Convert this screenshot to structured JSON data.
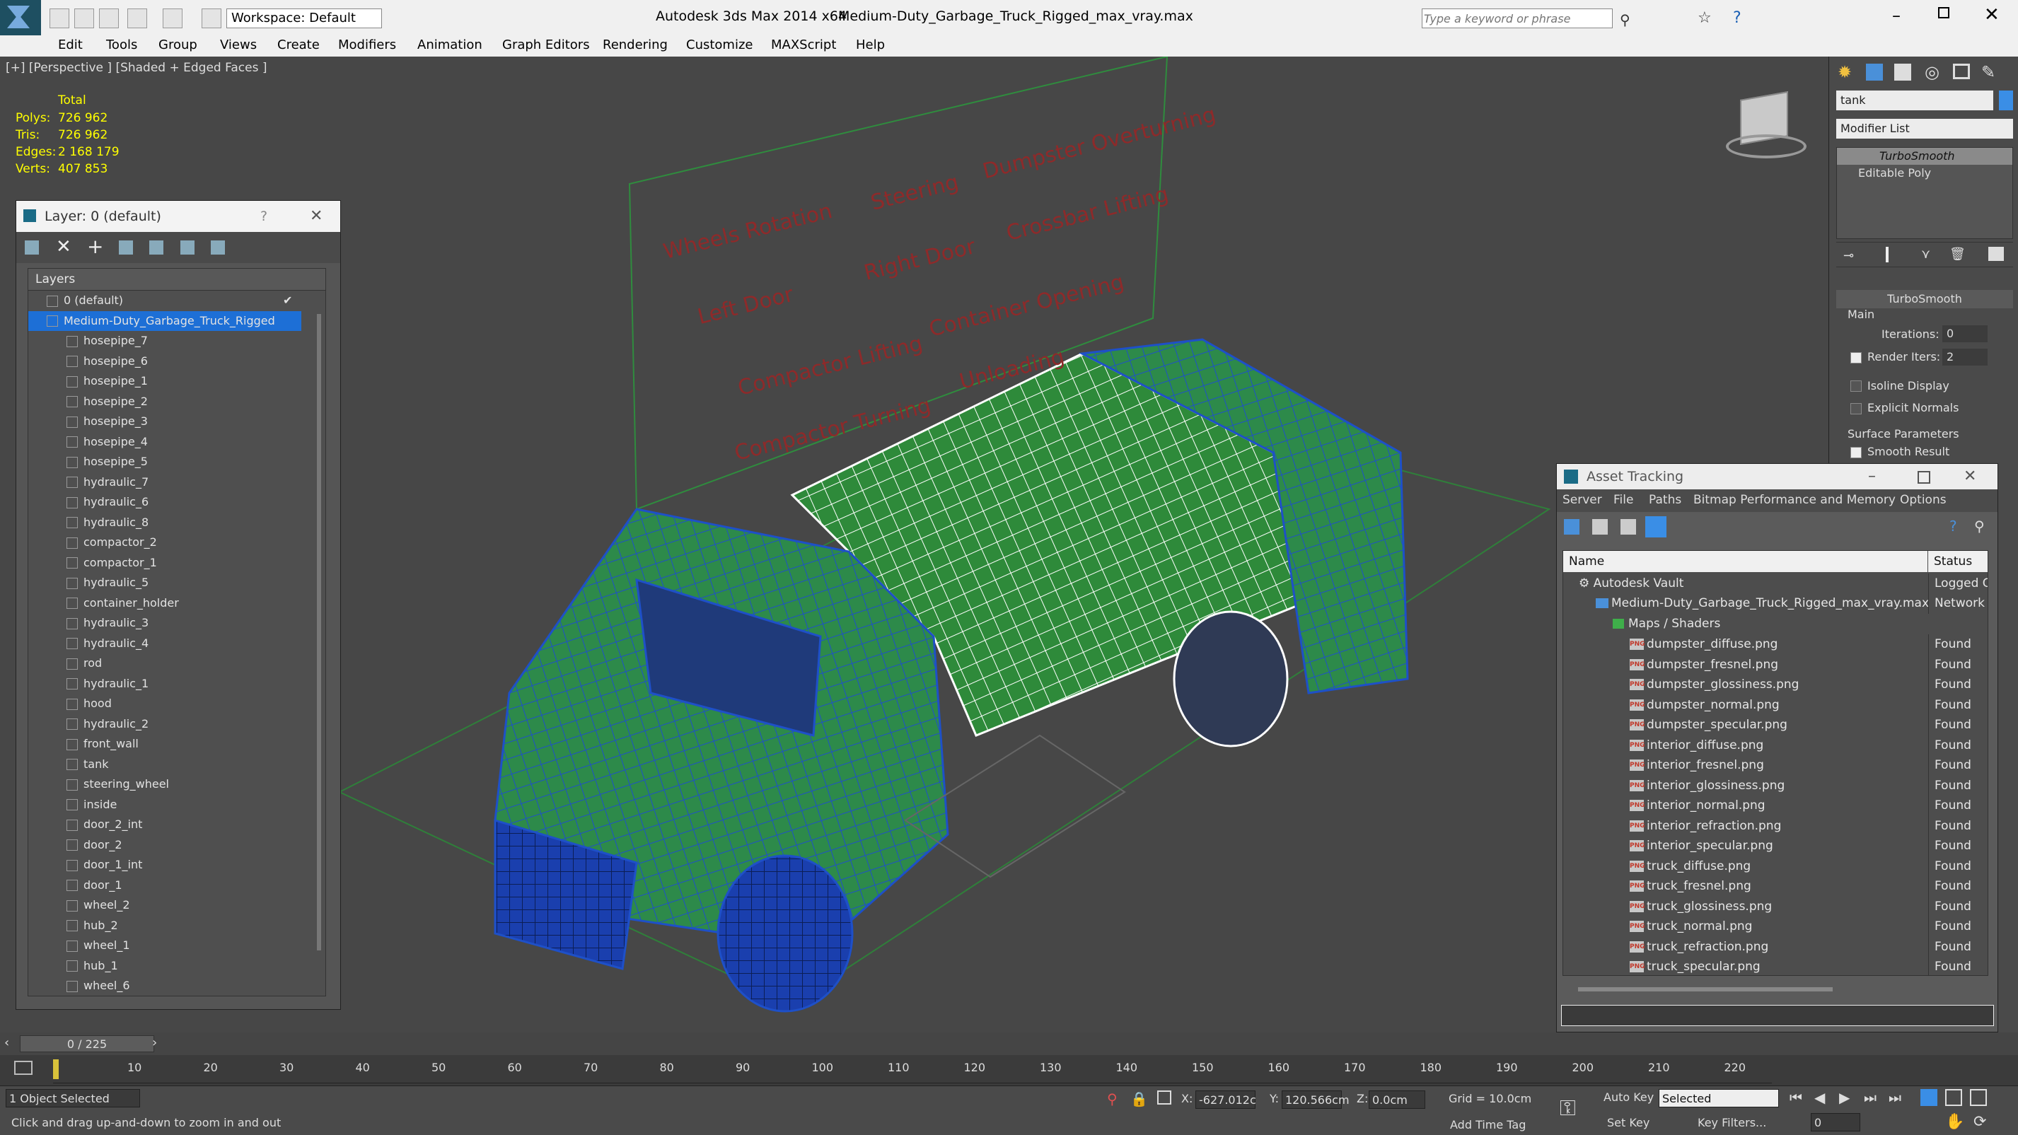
{
  "app": {
    "title": "Autodesk 3ds Max  2014 x64",
    "file": "Medium-Duty_Garbage_Truck_Rigged_max_vray.max",
    "workspace": "Workspace: Default",
    "search_placeholder": "Type a keyword or phrase"
  },
  "menu": [
    "Edit",
    "Tools",
    "Group",
    "Views",
    "Create",
    "Modifiers",
    "Animation",
    "Graph Editors",
    "Rendering",
    "Customize",
    "MAXScript",
    "Help"
  ],
  "viewport": {
    "label": "[+] [Perspective ] [Shaded + Edged Faces ]",
    "stats": {
      "total_label": "Total",
      "rows": [
        {
          "label": "Polys:",
          "value": "726 962"
        },
        {
          "label": "Tris:",
          "value": "726 962"
        },
        {
          "label": "Edges:",
          "value": "2 168 179"
        },
        {
          "label": "Verts:",
          "value": "407 853"
        }
      ]
    },
    "board_labels": [
      "Wheels Rotation",
      "Steering",
      "Dumpster Overturning",
      "Left Door",
      "Right Door",
      "Crossbar Lifting",
      "Compactor Lifting",
      "Container Opening",
      "Compactor Turning",
      "Unloading"
    ]
  },
  "layer_panel": {
    "title": "Layer: 0 (default)",
    "help": "?",
    "column": "Layers",
    "top_layers": [
      "0 (default)",
      "Medium-Duty_Garbage_Truck_Rigged"
    ],
    "items": [
      "hosepipe_7",
      "hosepipe_6",
      "hosepipe_1",
      "hosepipe_2",
      "hosepipe_3",
      "hosepipe_4",
      "hosepipe_5",
      "hydraulic_7",
      "hydraulic_6",
      "hydraulic_8",
      "compactor_2",
      "compactor_1",
      "hydraulic_5",
      "container_holder",
      "hydraulic_3",
      "hydraulic_4",
      "rod",
      "hydraulic_1",
      "hood",
      "hydraulic_2",
      "front_wall",
      "tank",
      "steering_wheel",
      "inside",
      "door_2_int",
      "door_2",
      "door_1_int",
      "door_1",
      "wheel_2",
      "hub_2",
      "wheel_1",
      "hub_1",
      "wheel_6"
    ]
  },
  "command_panel": {
    "object_name": "tank",
    "modifier_list": "Modifier List",
    "stack": [
      "TurboSmooth",
      "Editable Poly"
    ],
    "rollout": "TurboSmooth",
    "main_group": "Main",
    "iterations_label": "Iterations:",
    "iterations": "0",
    "render_iters_label": "Render Iters:",
    "render_iters": "2",
    "isoline": "Isoline Display",
    "explicit": "Explicit Normals",
    "surface_group": "Surface Parameters",
    "smooth_result": "Smooth Result"
  },
  "asset_tracking": {
    "title": "Asset Tracking",
    "menu": [
      "Server",
      "File",
      "Paths",
      "Bitmap Performance and Memory",
      "Options"
    ],
    "col_name": "Name",
    "col_status": "Status",
    "vault": {
      "name": "Autodesk Vault",
      "status": "Logged O"
    },
    "file": {
      "name": "Medium-Duty_Garbage_Truck_Rigged_max_vray.max",
      "status": "Network"
    },
    "group": "Maps / Shaders",
    "png_tag": "PNG",
    "maps": [
      {
        "name": "dumpster_diffuse.png",
        "status": "Found"
      },
      {
        "name": "dumpster_fresnel.png",
        "status": "Found"
      },
      {
        "name": "dumpster_glossiness.png",
        "status": "Found"
      },
      {
        "name": "dumpster_normal.png",
        "status": "Found"
      },
      {
        "name": "dumpster_specular.png",
        "status": "Found"
      },
      {
        "name": "interior_diffuse.png",
        "status": "Found"
      },
      {
        "name": "interior_fresnel.png",
        "status": "Found"
      },
      {
        "name": "interior_glossiness.png",
        "status": "Found"
      },
      {
        "name": "interior_normal.png",
        "status": "Found"
      },
      {
        "name": "interior_refraction.png",
        "status": "Found"
      },
      {
        "name": "interior_specular.png",
        "status": "Found"
      },
      {
        "name": "truck_diffuse.png",
        "status": "Found"
      },
      {
        "name": "truck_fresnel.png",
        "status": "Found"
      },
      {
        "name": "truck_glossiness.png",
        "status": "Found"
      },
      {
        "name": "truck_normal.png",
        "status": "Found"
      },
      {
        "name": "truck_refraction.png",
        "status": "Found"
      },
      {
        "name": "truck_specular.png",
        "status": "Found"
      }
    ]
  },
  "timeline": {
    "frame": "0 / 225",
    "ticks": [
      "10",
      "20",
      "30",
      "40",
      "50",
      "60",
      "70",
      "80",
      "90",
      "100",
      "110",
      "120",
      "130",
      "140",
      "150",
      "160",
      "170",
      "180",
      "190",
      "200",
      "210",
      "220"
    ]
  },
  "status": {
    "selected": "1 Object Selected",
    "prompt": "Click and drag up-and-down to zoom in and out",
    "x_label": "X:",
    "x_val": "-627.012c",
    "y_label": "Y:",
    "y_val": "120.566cm",
    "z_label": "Z:",
    "z_val": "0.0cm",
    "grid": "Grid = 10.0cm",
    "auto_key": "Auto Key",
    "set_key": "Set Key",
    "selected_dd": "Selected",
    "key_filters": "Key Filters...",
    "add_time_tag": "Add Time Tag",
    "frame_field": "0"
  },
  "colors": {
    "accent": "#3a8ee6",
    "wire_green": "#2f8c3e",
    "wire_blue": "#1e50c8",
    "board_red": "#8e2a2a"
  }
}
